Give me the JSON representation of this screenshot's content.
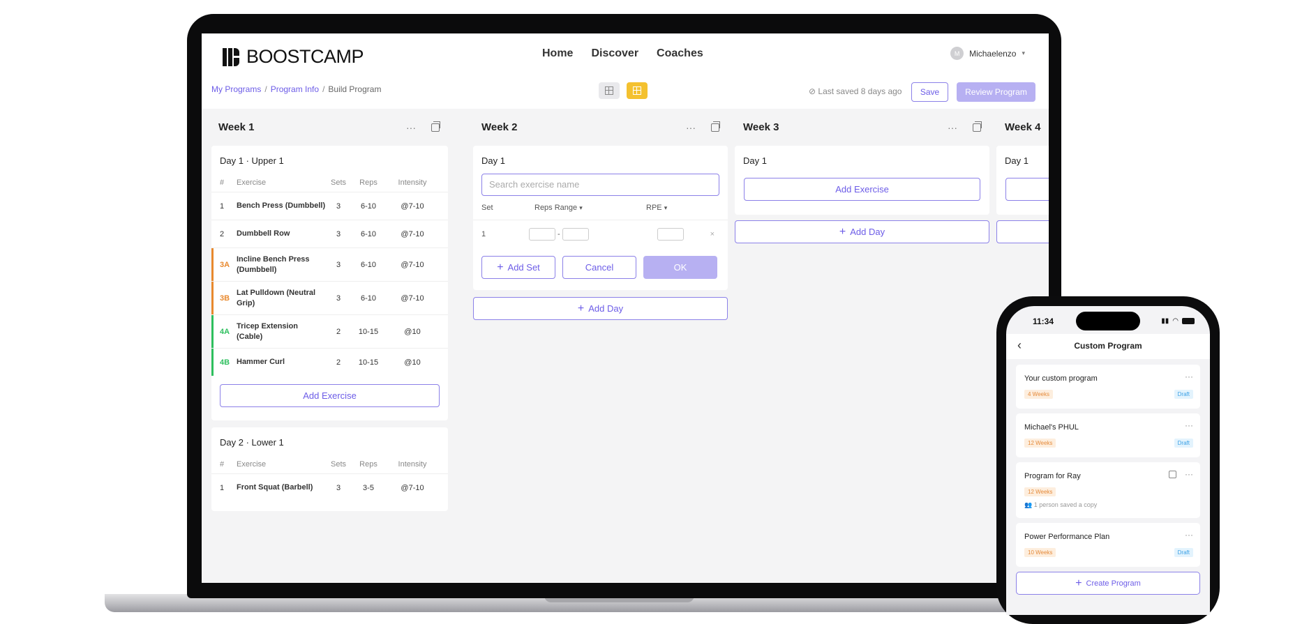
{
  "app": {
    "logo_text": "BOOSTCAMP",
    "nav": [
      "Home",
      "Discover",
      "Coaches"
    ],
    "user_name": "Michaelenzo",
    "breadcrumb": [
      "My Programs",
      "Program Info",
      "Build Program"
    ],
    "breadcrumb_sep": "/",
    "last_saved": "⊘ Last saved 8 days ago",
    "save_label": "Save",
    "review_label": "Review Program"
  },
  "table_headers": {
    "num": "#",
    "exercise": "Exercise",
    "sets": "Sets",
    "reps": "Reps",
    "intensity": "Intensity"
  },
  "colors": {
    "accent": "#6c5ce7",
    "toggle_active": "#f4c12f",
    "superset_orange": "#e8892e",
    "superset_green": "#2ebf5e"
  },
  "weeks": [
    {
      "title": "Week 1",
      "days": [
        {
          "title": "Day 1 · Upper 1",
          "rows": [
            {
              "num": "1",
              "exercise": "Bench Press (Dumbbell)",
              "sets": "3",
              "reps": "6-10",
              "intensity": "@7-10"
            },
            {
              "num": "2",
              "exercise": "Dumbbell Row",
              "sets": "3",
              "reps": "6-10",
              "intensity": "@7-10"
            },
            {
              "num": "3A",
              "exercise": "Incline Bench Press (Dumbbell)",
              "sets": "3",
              "reps": "6-10",
              "intensity": "@7-10"
            },
            {
              "num": "3B",
              "exercise": "Lat Pulldown (Neutral Grip)",
              "sets": "3",
              "reps": "6-10",
              "intensity": "@7-10"
            },
            {
              "num": "4A",
              "exercise": "Tricep Extension (Cable)",
              "sets": "2",
              "reps": "10-15",
              "intensity": "@10"
            },
            {
              "num": "4B",
              "exercise": "Hammer Curl",
              "sets": "2",
              "reps": "10-15",
              "intensity": "@10"
            }
          ],
          "add_label": "Add Exercise"
        },
        {
          "title": "Day 2 · Lower 1",
          "rows": [
            {
              "num": "1",
              "exercise": "Front Squat (Barbell)",
              "sets": "3",
              "reps": "3-5",
              "intensity": "@7-10"
            }
          ]
        }
      ]
    },
    {
      "title": "Week 2",
      "day_title": "Day 1",
      "search_placeholder": "Search exercise name",
      "set_header": "Set",
      "reps_range_label": "Reps Range",
      "rpe_label": "RPE",
      "set_number": "1",
      "dash": "-",
      "remove": "×",
      "add_set_label": "Add Set",
      "cancel_label": "Cancel",
      "ok_label": "OK",
      "add_day_label": "Add Day"
    },
    {
      "title": "Week 3",
      "day_title": "Day 1",
      "add_exercise_label": "Add Exercise",
      "add_day_label": "Add Day"
    },
    {
      "title": "Week 4",
      "day_title": "Day 1"
    }
  ],
  "phone": {
    "time": "11:34",
    "title": "Custom Program",
    "programs": [
      {
        "name": "Your custom program",
        "weeks": "4 Weeks",
        "status": "Draft"
      },
      {
        "name": "Michael's PHUL",
        "weeks": "12 Weeks",
        "status": "Draft"
      },
      {
        "name": "Program for Ray",
        "weeks": "12 Weeks",
        "saved": "1 person saved a copy"
      },
      {
        "name": "Power Performance Plan",
        "weeks": "10 Weeks",
        "status": "Draft"
      }
    ],
    "create_label": "Create Program"
  }
}
